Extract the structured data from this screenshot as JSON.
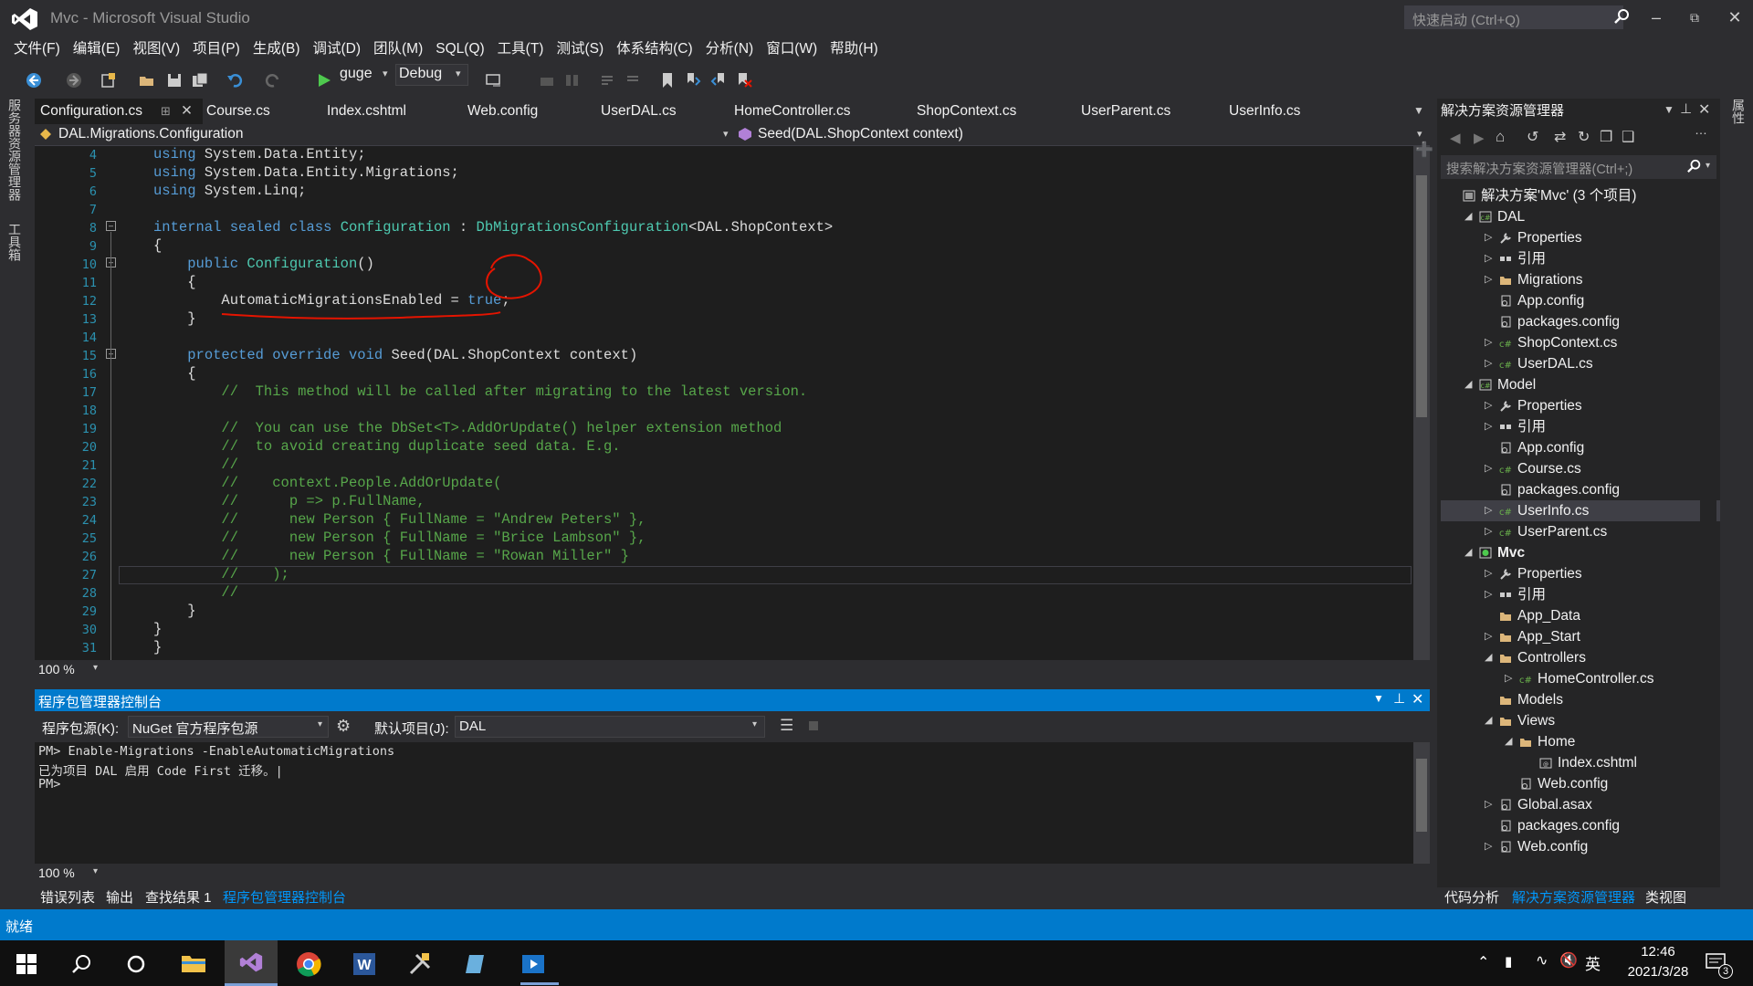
{
  "window": {
    "title": "Mvc - Microsoft Visual Studio",
    "quick_launch_placeholder": "快速启动 (Ctrl+Q)"
  },
  "menu": [
    "文件(F)",
    "编辑(E)",
    "视图(V)",
    "项目(P)",
    "生成(B)",
    "调试(D)",
    "团队(M)",
    "SQL(Q)",
    "工具(T)",
    "测试(S)",
    "体系结构(C)",
    "分析(N)",
    "窗口(W)",
    "帮助(H)"
  ],
  "toolbar": {
    "run_target": "guge",
    "configuration": "Debug"
  },
  "left_strip": [
    "服务器资源管理器",
    "工具箱"
  ],
  "tabs": [
    "Configuration.cs",
    "Course.cs",
    "Index.cshtml",
    "Web.config",
    "UserDAL.cs",
    "HomeController.cs",
    "ShopContext.cs",
    "UserParent.cs",
    "UserInfo.cs"
  ],
  "navbar": {
    "class": "DAL.Migrations.Configuration",
    "member": "Seed(DAL.ShopContext context)"
  },
  "code": {
    "line_numbers": [
      "4",
      "5",
      "6",
      "7",
      "8",
      "9",
      "10",
      "11",
      "12",
      "13",
      "14",
      "15",
      "16",
      "17",
      "18",
      "19",
      "20",
      "21",
      "22",
      "23",
      "24",
      "25",
      "26",
      "27",
      "28",
      "29",
      "30",
      "31"
    ],
    "lines": [
      "using System.Data.Entity;",
      "using System.Data.Entity.Migrations;",
      "using System.Linq;",
      "",
      "internal sealed class Configuration : DbMigrationsConfiguration<DAL.ShopContext>",
      "{",
      "    public Configuration()",
      "    {",
      "        AutomaticMigrationsEnabled = true;",
      "    }",
      "",
      "    protected override void Seed(DAL.ShopContext context)",
      "    {",
      "        //  This method will be called after migrating to the latest version.",
      "",
      "        //  You can use the DbSet<T>.AddOrUpdate() helper extension method",
      "        //  to avoid creating duplicate seed data. E.g.",
      "        //",
      "        //    context.People.AddOrUpdate(",
      "        //      p => p.FullName,",
      "        //      new Person { FullName = \"Andrew Peters\" },",
      "        //      new Person { FullName = \"Brice Lambson\" },",
      "        //      new Person { FullName = \"Rowan Miller\" }",
      "        //    );",
      "        //",
      "    }",
      "}",
      "}"
    ]
  },
  "zoom": "100 %",
  "pmc": {
    "title": "程序包管理器控制台",
    "source_label": "程序包源(K):",
    "source_value": "NuGet 官方程序包源",
    "project_label": "默认项目(J):",
    "project_value": "DAL",
    "console": [
      "PM> Enable-Migrations -EnableAutomaticMigrations",
      "已为项目 DAL 启用 Code First 迁移。|",
      "PM>"
    ]
  },
  "bottom_tabs": [
    "错误列表",
    "输出",
    "查找结果 1",
    "程序包管理器控制台"
  ],
  "solution_explorer": {
    "title": "解决方案资源管理器",
    "search_placeholder": "搜索解决方案资源管理器(Ctrl+;)",
    "items": [
      {
        "label": "解决方案'Mvc' (3 个项目)",
        "depth": 0,
        "arrow": "",
        "icon": "solution"
      },
      {
        "label": "DAL",
        "depth": 1,
        "arrow": "open",
        "icon": "csproj"
      },
      {
        "label": "Properties",
        "depth": 2,
        "arrow": "closed",
        "icon": "wrench"
      },
      {
        "label": "引用",
        "depth": 2,
        "arrow": "closed",
        "icon": "ref"
      },
      {
        "label": "Migrations",
        "depth": 2,
        "arrow": "closed",
        "icon": "folder"
      },
      {
        "label": "App.config",
        "depth": 2,
        "arrow": "",
        "icon": "config"
      },
      {
        "label": "packages.config",
        "depth": 2,
        "arrow": "",
        "icon": "config"
      },
      {
        "label": "ShopContext.cs",
        "depth": 2,
        "arrow": "closed",
        "icon": "cs"
      },
      {
        "label": "UserDAL.cs",
        "depth": 2,
        "arrow": "closed",
        "icon": "cs"
      },
      {
        "label": "Model",
        "depth": 1,
        "arrow": "open",
        "icon": "csproj"
      },
      {
        "label": "Properties",
        "depth": 2,
        "arrow": "closed",
        "icon": "wrench"
      },
      {
        "label": "引用",
        "depth": 2,
        "arrow": "closed",
        "icon": "ref"
      },
      {
        "label": "App.config",
        "depth": 2,
        "arrow": "",
        "icon": "config"
      },
      {
        "label": "Course.cs",
        "depth": 2,
        "arrow": "closed",
        "icon": "cs"
      },
      {
        "label": "packages.config",
        "depth": 2,
        "arrow": "",
        "icon": "config"
      },
      {
        "label": "UserInfo.cs",
        "depth": 2,
        "arrow": "closed",
        "icon": "cs",
        "selected": true
      },
      {
        "label": "UserParent.cs",
        "depth": 2,
        "arrow": "closed",
        "icon": "cs"
      },
      {
        "label": "Mvc",
        "depth": 1,
        "arrow": "open",
        "icon": "web",
        "bold": true
      },
      {
        "label": "Properties",
        "depth": 2,
        "arrow": "closed",
        "icon": "wrench"
      },
      {
        "label": "引用",
        "depth": 2,
        "arrow": "closed",
        "icon": "ref"
      },
      {
        "label": "App_Data",
        "depth": 2,
        "arrow": "",
        "icon": "folder"
      },
      {
        "label": "App_Start",
        "depth": 2,
        "arrow": "closed",
        "icon": "folder"
      },
      {
        "label": "Controllers",
        "depth": 2,
        "arrow": "open",
        "icon": "folder"
      },
      {
        "label": "HomeController.cs",
        "depth": 3,
        "arrow": "closed",
        "icon": "cs"
      },
      {
        "label": "Models",
        "depth": 2,
        "arrow": "",
        "icon": "folder"
      },
      {
        "label": "Views",
        "depth": 2,
        "arrow": "open",
        "icon": "folder"
      },
      {
        "label": "Home",
        "depth": 3,
        "arrow": "open",
        "icon": "folder"
      },
      {
        "label": "Index.cshtml",
        "depth": 4,
        "arrow": "",
        "icon": "cshtml"
      },
      {
        "label": "Web.config",
        "depth": 3,
        "arrow": "",
        "icon": "config"
      },
      {
        "label": "Global.asax",
        "depth": 2,
        "arrow": "closed",
        "icon": "config"
      },
      {
        "label": "packages.config",
        "depth": 2,
        "arrow": "",
        "icon": "config"
      },
      {
        "label": "Web.config",
        "depth": 2,
        "arrow": "closed",
        "icon": "config"
      }
    ],
    "bottom_tabs": [
      "代码分析",
      "解决方案资源管理器",
      "类视图"
    ]
  },
  "right_strip": "属性",
  "status": "就绪",
  "taskbar": {
    "time": "12:46",
    "date": "2021/3/28",
    "ime": "英",
    "notifications": "3"
  },
  "colors": {
    "accent": "#007acc",
    "keyword": "#569cd6",
    "type": "#4ec9b0",
    "comment": "#57a64a",
    "annotation": "#e51400"
  }
}
